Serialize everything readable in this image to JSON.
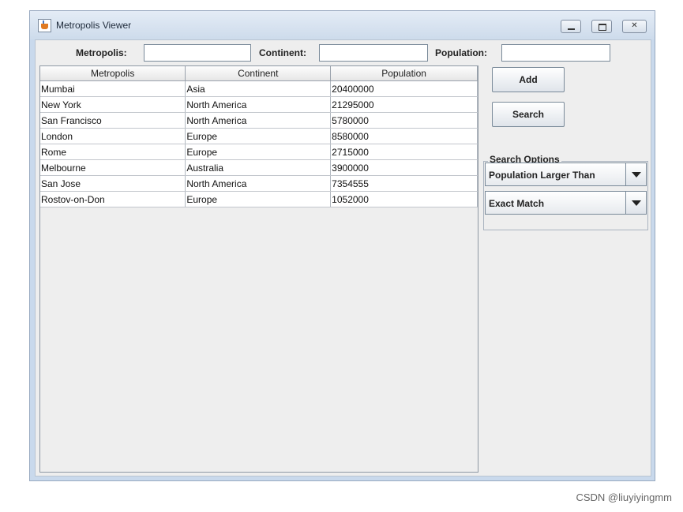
{
  "window": {
    "title": "Metropolis Viewer"
  },
  "form": {
    "metropolis_label": "Metropolis:",
    "metropolis_value": "",
    "continent_label": "Continent:",
    "continent_value": "",
    "population_label": "Population:",
    "population_value": ""
  },
  "table": {
    "columns": [
      "Metropolis",
      "Continent",
      "Population"
    ],
    "rows": [
      [
        "Mumbai",
        "Asia",
        "20400000"
      ],
      [
        "New York",
        "North America",
        "21295000"
      ],
      [
        "San Francisco",
        "North America",
        "5780000"
      ],
      [
        "London",
        "Europe",
        "8580000"
      ],
      [
        "Rome",
        "Europe",
        "2715000"
      ],
      [
        "Melbourne",
        "Australia",
        "3900000"
      ],
      [
        "San Jose",
        "North America",
        "7354555"
      ],
      [
        "Rostov-on-Don",
        "Europe",
        "1052000"
      ]
    ]
  },
  "buttons": {
    "add": "Add",
    "search": "Search"
  },
  "search_options": {
    "title": "Search Options",
    "mode_selected": "Population Larger Than",
    "match_selected": "Exact Match"
  },
  "watermark": "CSDN @liuyiyingmm",
  "icons": {
    "app": "java-cup-icon",
    "minimize": "minimize-icon",
    "maximize": "maximize-icon",
    "close": "close-icon",
    "dropdown": "chevron-down-icon"
  }
}
